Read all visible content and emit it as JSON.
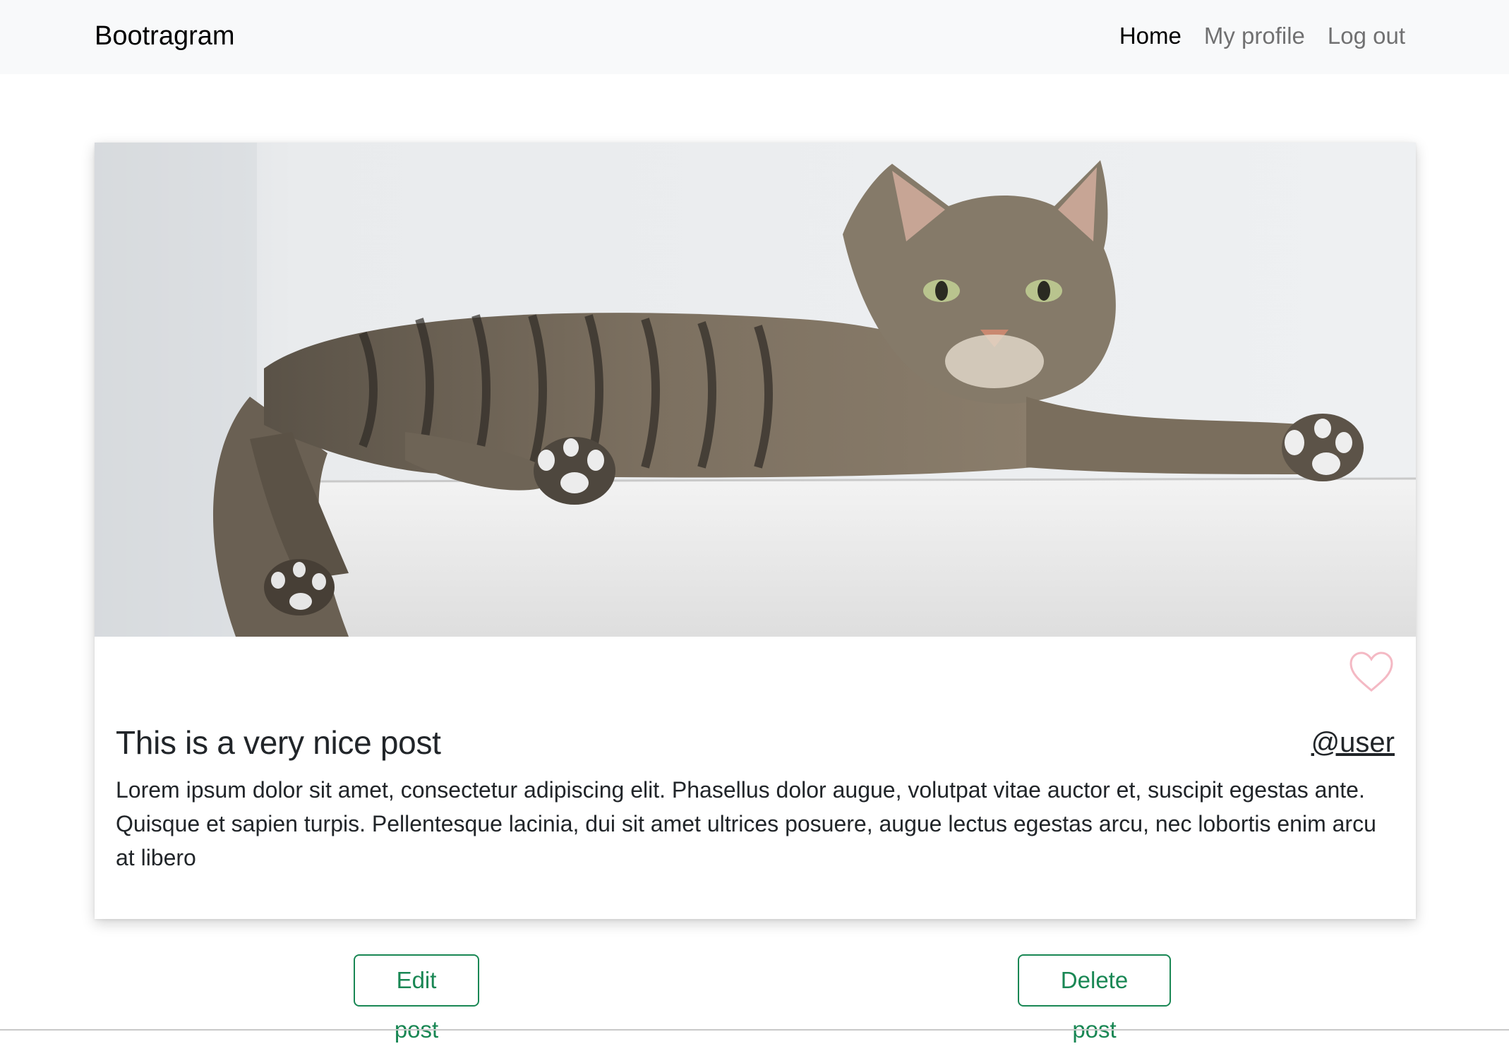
{
  "navbar": {
    "brand": "Bootragram",
    "links": [
      {
        "label": "Home",
        "active": true
      },
      {
        "label": "My profile",
        "active": false
      },
      {
        "label": "Log out",
        "active": false
      }
    ]
  },
  "post": {
    "image_alt": "Tabby cat lying on a white ledge",
    "title": "This is a very nice post",
    "author": "@user",
    "body": "Lorem ipsum dolor sit amet, consectetur adipiscing elit. Phasellus dolor augue, volutpat vitae auctor et, suscipit egestas ante. Quisque et sapien turpis. Pellentesque lacinia, dui sit amet ultrices posuere, augue lectus egestas arcu, nec lobortis enim arcu at libero",
    "liked": false
  },
  "actions": {
    "edit_label": "Edit post",
    "delete_label": "Delete post"
  },
  "colors": {
    "navbar_bg": "#f8f9fa",
    "accent_green": "#198754",
    "heart_outline": "#f4b9c4"
  }
}
